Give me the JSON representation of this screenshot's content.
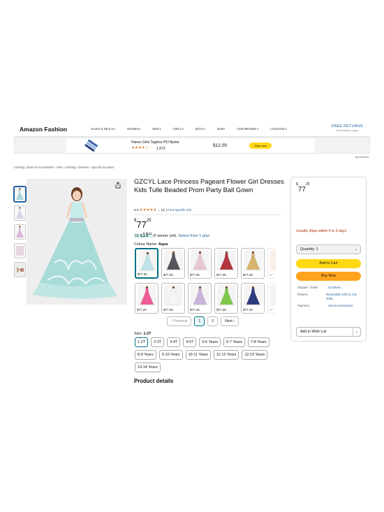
{
  "header": {
    "logo": "Amazon Fashion",
    "nav": [
      "SALES & DEALS",
      "WOMEN",
      "MEN",
      "GIRLS",
      "BOYS",
      "BABY",
      "OUR BRANDS",
      "LUGGAGE"
    ],
    "nav_caret": "▾",
    "free_returns": "FREE RETURNS",
    "restrictions": "Restrictions Apply"
  },
  "ad": {
    "title": "Hanes Girls Tagless P9 Hipster",
    "stars": "★★★★☆",
    "count": "1,973",
    "price": "$12.09",
    "shop_now": "Shop now",
    "sponsored": "Sponsored"
  },
  "breadcrumb": "Clothing, Shoes & Accessories › Girls › Clothing › Dresses › Special Occasion",
  "product": {
    "title": "GZCYL Lace Princess Pageant Flower Girl Dresses Kids Tulle Beaded Prom Party Ball Gown",
    "rating": "5.0",
    "stars": "★★★★★",
    "rating_count": "(1)",
    "find_info": "Find specific info",
    "price_symbol": "$",
    "price_whole": "77",
    "price_fraction": "25",
    "install_prefix": "Or ",
    "install_symbol": "$",
    "install_whole": "19",
    "install_fraction": "31",
    "install_suffix": "/2 weeks (x4).",
    "install_link": "Select from 1 plan",
    "colour_label": "Colour Name:",
    "colour_value": "Aqua",
    "swatch_price": "$77.25",
    "swatch_price_partial": "$7",
    "swatches_row1": [
      "#bfe3e8",
      "#55555e",
      "#e8c8cf",
      "#b2363f",
      "#d6b470"
    ],
    "swatches_row2": [
      "#ee5d95",
      "#f5f5f5",
      "#c9b3d8",
      "#7ec94c",
      "#2c3c7e"
    ],
    "fade_colors": [
      "#f2d0c0",
      "#dcdcdc"
    ],
    "pager": {
      "prev": "Previous",
      "p1": "1",
      "p2": "2",
      "next": "Next"
    },
    "size_label": "Size:",
    "size_value": "1-2T",
    "sizes": [
      "1-2T",
      "2-3T",
      "3-4T",
      "4-5T",
      "5-6 Years",
      "6-7 Years",
      "7-8 Years",
      "8-9 Years",
      "9-10 Years",
      "10-11 Years",
      "11-12 Years",
      "12-13 Years",
      "13-14 Years"
    ],
    "details_heading": "Product details"
  },
  "buybox": {
    "price_symbol": "$",
    "price_whole": "77",
    "price_fraction": "25",
    "ships": "Usually ships within 4 to 5 days",
    "quantity": "Quantity: 1",
    "add_to_cart": "Add to Cart",
    "buy_now": "Buy Now",
    "shipper_label": "Shipper / Seller",
    "shipper_value": "Gzcdress",
    "returns_label": "Returns",
    "returns_value": "Returnable until 31 Jan 2026",
    "payment_label": "Payment",
    "payment_value": "Secure transaction",
    "wishlist": "Add to Wish List"
  },
  "colors": {
    "accent": "#007185",
    "link": "#2162a1",
    "add_to_cart": "#ffd814",
    "buy_now": "#ffa41c",
    "ship_warning": "#b12704",
    "star": "#de7921"
  }
}
